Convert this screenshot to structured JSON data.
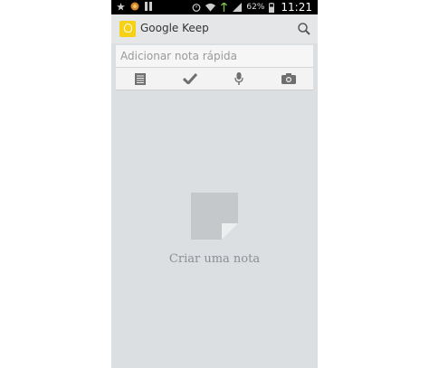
{
  "status_bar": {
    "battery": "62%",
    "time": "11:21"
  },
  "app_bar": {
    "title": "Google Keep",
    "icons": [
      "keep-logo-icon",
      "search-icon"
    ]
  },
  "quick_note": {
    "placeholder": "Adicionar nota rápida"
  },
  "note_toolbar": {
    "icons": [
      "list-note-icon",
      "checkmark-icon",
      "microphone-icon",
      "camera-icon"
    ]
  },
  "empty_state": {
    "text": "Criar uma nota",
    "icon": "note-icon"
  },
  "colors": {
    "accent": "#f7d117",
    "background": "#dcdfe2",
    "statusbar": "#000000"
  }
}
